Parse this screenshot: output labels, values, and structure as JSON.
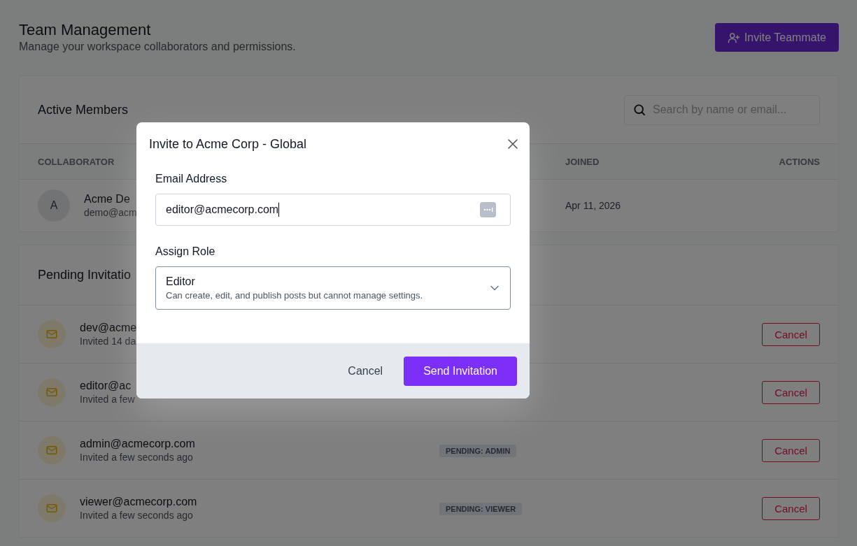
{
  "page": {
    "title": "Team Management",
    "subtitle": "Manage your workspace collaborators and permissions.",
    "invite_button": "Invite Teammate"
  },
  "active_members": {
    "title": "Active Members",
    "search": {
      "placeholder": "Search by name or email..."
    },
    "columns": [
      "COLLABORATOR",
      "JOINED",
      "ACTIONS"
    ],
    "rows": [
      {
        "initial": "A",
        "name": "Acme De",
        "email": "demo@acm",
        "joined": "Apr 11, 2026"
      }
    ]
  },
  "pending_invitations": {
    "title": "Pending Invitatio",
    "rows": [
      {
        "email": "dev@acme",
        "invited": "Invited 14 da",
        "action": "Cancel"
      },
      {
        "email": "editor@ac",
        "invited": "Invited a few",
        "action": "Cancel"
      },
      {
        "email": "admin@acmecorp.com",
        "invited": "Invited a few seconds ago",
        "badge": "PENDING: ADMIN",
        "action": "Cancel"
      },
      {
        "email": "viewer@acmecorp.com",
        "invited": "Invited a few seconds ago",
        "badge": "PENDING: VIEWER",
        "action": "Cancel"
      }
    ]
  },
  "modal": {
    "title": "Invite to Acme Corp - Global",
    "email_label": "Email Address",
    "email_value": "editor@acmecorp.com",
    "role_label": "Assign Role",
    "role": {
      "name": "Editor",
      "description": "Can create, edit, and publish posts but cannot manage settings."
    },
    "cancel": "Cancel",
    "submit": "Send Invitation"
  }
}
